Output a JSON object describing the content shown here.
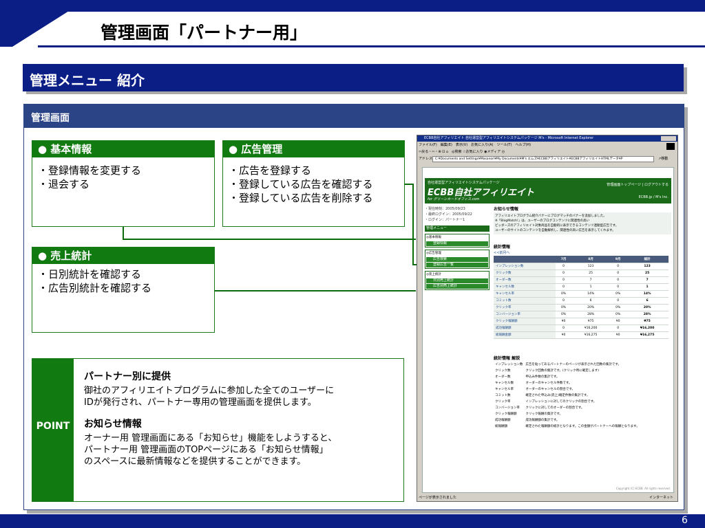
{
  "slide_title": "管理画面「パートナー用」",
  "section_title": "管理メニュー 紹介",
  "panel_title": "管理画面",
  "boxes": {
    "basic": {
      "title": "● 基本情報",
      "items": [
        "・登録情報を変更する",
        "・退会する"
      ]
    },
    "ads": {
      "title": "● 広告管理",
      "items": [
        "・広告を登録する",
        "・登録している広告を確認する",
        "・登録している広告を削除する"
      ]
    },
    "sales": {
      "title": "● 売上統計",
      "items": [
        "・日別統計を確認する",
        "・広告別統計を確認する"
      ]
    }
  },
  "point": {
    "label": "POINT",
    "h1": "パートナー別に提供",
    "t1": [
      "御社のアフィリエイトプログラムに参加した全てのユーザーに",
      "IDが発行され、パートナー専用の管理画面を提供します。"
    ],
    "h2": "お知らせ情報",
    "t2": [
      "オーナー用 管理画面にある「お知らせ」機能をしようすると、",
      "パートナー用 管理画面のTOPページにある「お知らせ情報」",
      "のスペースに最新情報などを提供することができます。"
    ]
  },
  "page_number": "6",
  "colors": {
    "navy": "#0b1e86",
    "panel_blue": "#2a4486",
    "green": "#117a11"
  },
  "screenshot": {
    "window_title": "ECBB自社アフィリエイト 自社運営型アフィリエイトシステムパッケージ M's - Microsoft Internet Explorer",
    "menubar": "ファイル(F)　編集(E)　表示(V)　お気に入り(A)　ツール(T)　ヘルプ(H)",
    "toolbar": "⇦戻る・⇨・⊗ ⊡ ⌂　◎検索 ☆お気に入り ◉メディア ◷",
    "address_label": "アドレス(D)",
    "address": "C:¥Documents and Settings¥Masanori¥My Documents¥M's エムズ¥ECBBアフィリエイト¥ECBBアフィリエイトHTMLデータ¥P",
    "go": "↗移動",
    "brand_small": "自社運営型アフィリエイトシステムパッケージ",
    "brand": "ECBB自社アフィリエイト",
    "brand_sub": "for グリーンカードオフィス.com",
    "banner_links": "管理画面トップページ | ログアウトする",
    "banner_domain": "ECBB.jp / M's Inc.",
    "meta": [
      "・現在時刻：2005/09/23",
      "・最終ログイン：2005/09/22",
      "・ログイン：パートナー1"
    ],
    "menu_title": "管理メニュー",
    "groups": [
      {
        "title": "◎基本情報",
        "items": [
          "登録情報"
        ]
      },
      {
        "title": "◎広告管理",
        "items": [
          "広告検索",
          "登録広告一覧"
        ]
      },
      {
        "title": "◎売上統計",
        "items": [
          "日別売上統計",
          "広告別売上統計"
        ]
      }
    ],
    "notice_title": "お知らせ情報",
    "notice_lines": [
      "アフィリエイトプログラム紹介バナーにブログマッチのバナーを追加しました。",
      "※「BlogMatch!」は、ユーザーのブログコンテンツに関連性の高い",
      "ビッダーズのアフィリエイト対象商品を自動的に表示できるコンテンツ連動型広告です。",
      "ユーザーのサイトのコンテンツを自動解析し、関連性の高い広告を表示してくれます。"
    ],
    "stats_title": "統計情報",
    "prev_month": "<<前月へ",
    "table_headers": [
      "",
      "7月",
      "8月",
      "9月",
      "総計"
    ],
    "table_rows": [
      [
        "インプレッション数",
        "0",
        "123",
        "0",
        "123"
      ],
      [
        "クリック数",
        "0",
        "25",
        "0",
        "25"
      ],
      [
        "オーダー数",
        "0",
        "7",
        "0",
        "7"
      ],
      [
        "キャンセル数",
        "0",
        "1",
        "0",
        "1"
      ],
      [
        "キャンセル率",
        "0%",
        "14%",
        "0%",
        "14%"
      ],
      [
        "コミット数",
        "0",
        "6",
        "0",
        "6"
      ],
      [
        "クリック率",
        "0%",
        "20%",
        "0%",
        "20%"
      ],
      [
        "コンバージョン率",
        "0%",
        "28%",
        "0%",
        "28%"
      ],
      [
        "クリック報酬額",
        "¥0",
        "¥75",
        "¥0",
        "¥75"
      ],
      [
        "成功報酬額",
        "0",
        "¥16,200",
        "0",
        "¥16,200"
      ],
      [
        "総報酬金額",
        "¥0",
        "¥16,275",
        "¥0",
        "¥16,275"
      ]
    ],
    "explain_title": "統計情報 解説",
    "explain_rows": [
      [
        "インプレッション数",
        "広告を貼ってあるパートナーのページが表示された回数の集計です。"
      ],
      [
        "クリック数",
        "クリック回数の集計です。(クリック時に確定します)"
      ],
      [
        "オーダー数",
        "申込み件数の集計です。"
      ],
      [
        "キャンセル数",
        "オーダーのキャンセル件数です。"
      ],
      [
        "キャンセル率",
        "オーダーのキャンセルの割合です。"
      ],
      [
        "コミット数",
        "確定された申込み(売上)確定件数の集計です。"
      ],
      [
        "クリック率",
        "インプレッションに対してのクリックの割合です。"
      ],
      [
        "コンバージョン率",
        "クリックに対してのオーダーの割合です。"
      ],
      [
        "クリック報酬額",
        "クリック報酬の集計です。"
      ],
      [
        "成功報酬額",
        "成功報酬額の集計です。"
      ],
      [
        "総報酬額",
        "確定された報酬額の総計となります。この金額がパートナーへの報酬となります。"
      ]
    ],
    "copyright": "Copyright (C) ECBB. All rights reserved.",
    "status_left": "ページが表示されました",
    "status_right": "インターネット"
  }
}
